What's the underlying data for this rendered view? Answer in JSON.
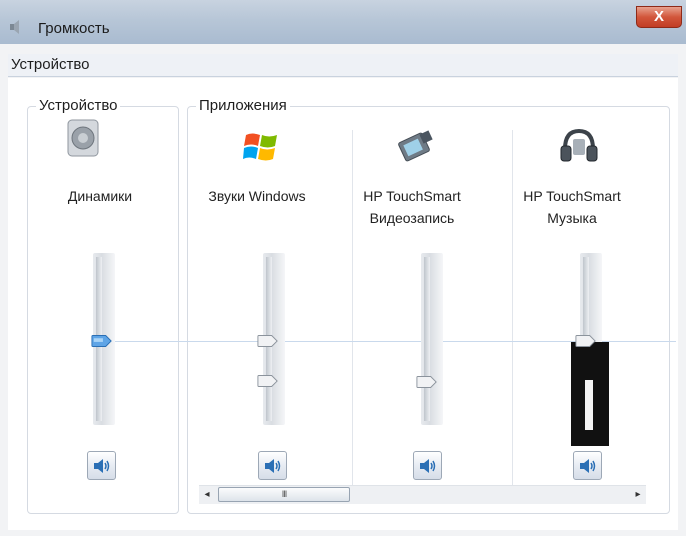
{
  "window": {
    "title": "Громкость",
    "close_glyph": "X"
  },
  "menu": {
    "items": [
      {
        "label": "Устройство"
      }
    ]
  },
  "device_group": {
    "legend": "Устройство",
    "device": {
      "icon": "speaker-icon",
      "label": "Динамики",
      "volume_percent": 50,
      "muted": false
    }
  },
  "apps_group": {
    "legend": "Приложения",
    "apps": [
      {
        "icon": "windows-flag-icon",
        "label_line1": "Звуки Windows",
        "label_line2": "",
        "volume_percent": 50,
        "muted": false
      },
      {
        "icon": "video-recorder-icon",
        "label_line1": "HP TouchSmart",
        "label_line2": "Видеозапись",
        "volume_percent": 25,
        "muted": false
      },
      {
        "icon": "headphones-icon",
        "label_line1": "HP TouchSmart",
        "label_line2": "Музыка",
        "volume_percent": 50,
        "muted": false
      }
    ]
  },
  "scrollbar": {
    "grip_glyph": "III"
  }
}
